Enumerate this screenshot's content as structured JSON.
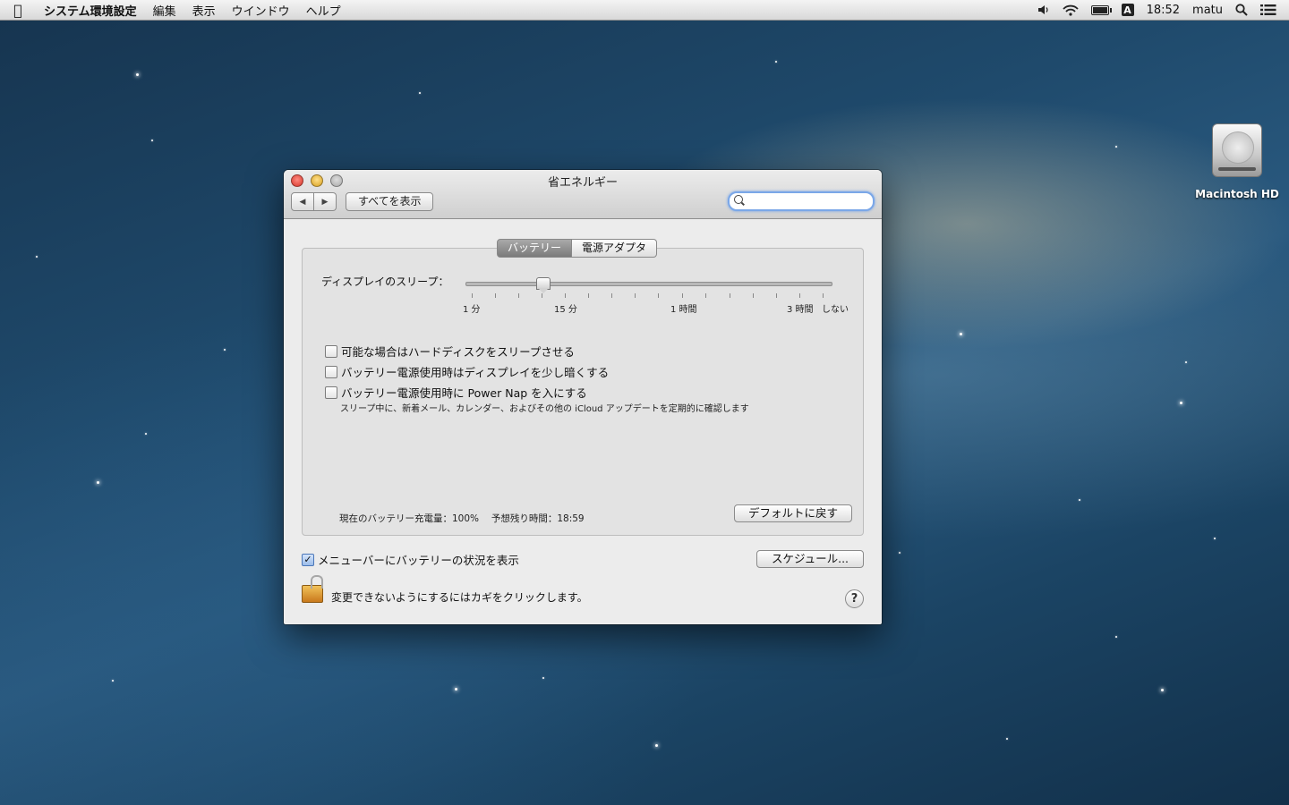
{
  "menubar": {
    "apple_icon": "apple-icon",
    "items": [
      "システム環境設定",
      "編集",
      "表示",
      "ウインドウ",
      "ヘルプ"
    ],
    "input_source": "A",
    "battery_level": 1.0,
    "clock": "18:52",
    "user": "matu"
  },
  "desktop": {
    "hd_label": "Macintosh HD"
  },
  "window": {
    "title": "省エネルギー",
    "back": "◀",
    "forward": "▶",
    "show_all": "すべてを表示",
    "search_placeholder": "",
    "tabs": [
      {
        "label": "バッテリー",
        "selected": true
      },
      {
        "label": "電源アダプタ",
        "selected": false
      }
    ],
    "slider": {
      "label": "ディスプレイのスリープ：",
      "value": "15 分",
      "tick_labels": [
        "1 分",
        "15 分",
        "1 時間",
        "3 時間",
        "しない"
      ]
    },
    "options": [
      {
        "label": "可能な場合はハードディスクをスリープさせる",
        "checked": false
      },
      {
        "label": "バッテリー電源使用時はディスプレイを少し暗くする",
        "checked": false
      },
      {
        "label": "バッテリー電源使用時に Power Nap を入にする",
        "checked": false
      }
    ],
    "power_nap_note": "スリープ中に、新着メール、カレンダー、およびその他の iCloud アップデートを定期的に確認します",
    "status": "現在のバッテリー充電量：100%　 予想残り時間：18:59",
    "default_button": "デフォルトに戻す",
    "show_battery_status": {
      "label": "メニューバーにバッテリーの状況を表示",
      "checked": true
    },
    "schedule_button": "スケジュール...",
    "lock_text": "変更できないようにするにはカギをクリックします。",
    "help": "?"
  }
}
